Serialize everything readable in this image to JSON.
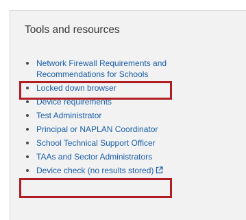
{
  "panel": {
    "title": "Tools and resources",
    "items": [
      {
        "line1": "Network Firewall Requirements and",
        "line2": "Recommendations for Schools"
      },
      {
        "label": "Locked down browser"
      },
      {
        "label": "Device requirements",
        "highlighted": true
      },
      {
        "label": "Test Administrator"
      },
      {
        "label": "Principal or NAPLAN Coordinator"
      },
      {
        "label": "School Technical Support Officer"
      },
      {
        "label": "TAAs and Sector Administrators"
      },
      {
        "label": "Device check (no results stored)",
        "icon": "external-link-icon",
        "highlighted": true
      }
    ]
  },
  "colors": {
    "link": "#1a5fa8",
    "highlight": "#b01e23",
    "panel_bg": "#f2f2f2"
  }
}
